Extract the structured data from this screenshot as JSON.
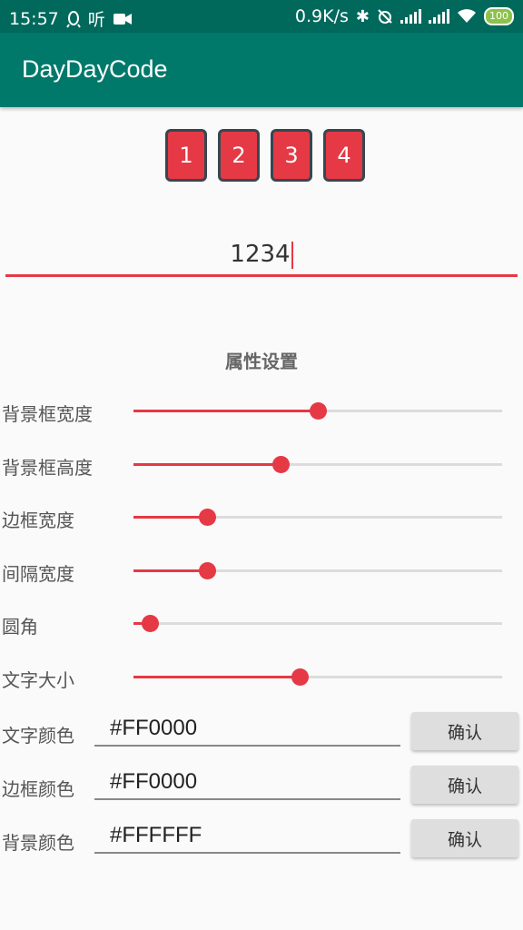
{
  "status_bar": {
    "time": "15:57",
    "ting_label": "听",
    "net_speed": "0.9K/s",
    "battery": "100"
  },
  "app_bar": {
    "title": "DayDayCode"
  },
  "code_boxes": [
    "1",
    "2",
    "3",
    "4"
  ],
  "code_input": {
    "value": "1234"
  },
  "settings": {
    "title": "属性设置",
    "sliders": [
      {
        "label": "背景框宽度",
        "level": 0.5
      },
      {
        "label": "背景框高度",
        "level": 0.4
      },
      {
        "label": "边框宽度",
        "level": 0.2
      },
      {
        "label": "间隔宽度",
        "level": 0.2
      },
      {
        "label": "圆角",
        "level": 0.045
      },
      {
        "label": "文字大小",
        "level": 0.45
      }
    ],
    "colors": [
      {
        "label": "文字颜色",
        "value": "#FF0000",
        "button": "确认"
      },
      {
        "label": "边框颜色",
        "value": "#FF0000",
        "button": "确认"
      },
      {
        "label": "背景颜色",
        "value": "#FFFFFF",
        "button": "确认"
      }
    ]
  },
  "theme": {
    "primary": "#00796b",
    "primary_dark": "#00695c",
    "accent": "#e53945"
  }
}
